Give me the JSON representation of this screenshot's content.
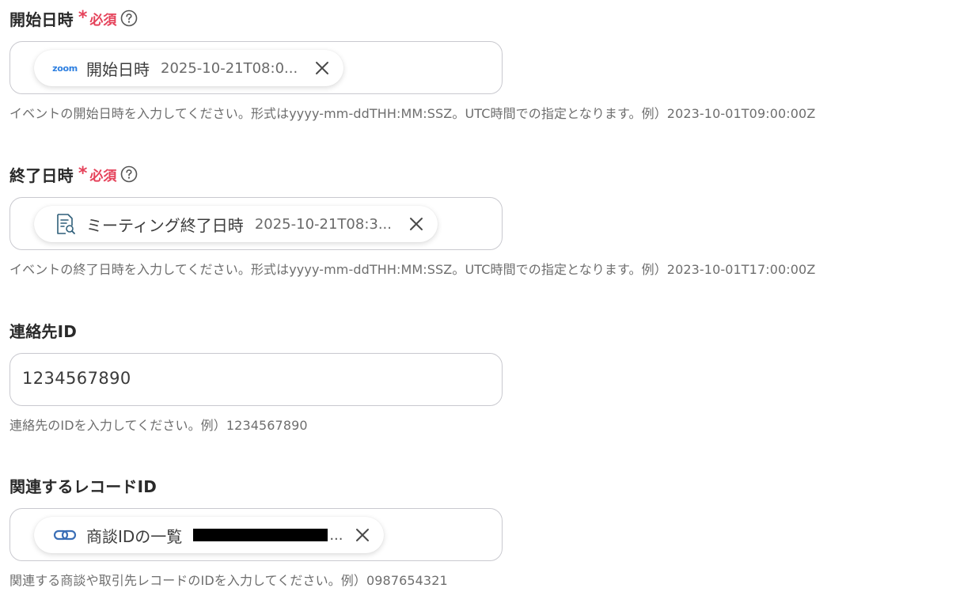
{
  "fields": [
    {
      "label": "開始日時",
      "required_star": "*",
      "required_text": "必須",
      "help_icon": "question-circle-icon",
      "chip": {
        "icon": "zoom-logo-icon",
        "icon_text": "zoom",
        "name": "開始日時",
        "value": "2025-10-21T08:0..."
      },
      "description": "イベントの開始日時を入力してください。形式はyyyy-mm-ddTHH:MM:SSZ。UTC時間での指定となります。例）2023-10-01T09:00:00Z"
    },
    {
      "label": "終了日時",
      "required_star": "*",
      "required_text": "必須",
      "help_icon": "question-circle-icon",
      "chip": {
        "icon": "document-search-icon",
        "name": "ミーティング終了日時",
        "value": "2025-10-21T08:3..."
      },
      "description": "イベントの終了日時を入力してください。形式はyyyy-mm-ddTHH:MM:SSZ。UTC時間での指定となります。例）2023-10-01T17:00:00Z"
    },
    {
      "label": "連絡先ID",
      "value": "1234567890",
      "description": "連絡先のIDを入力してください。例）1234567890"
    },
    {
      "label": "関連するレコードID",
      "chip": {
        "icon": "chain-link-icon",
        "name": "商談IDの一覧",
        "value": "..."
      },
      "description": "関連する商談や取引先レコードのIDを入力してください。例）0987654321"
    }
  ],
  "colors": {
    "required": "#e5425a",
    "border": "#c9c9cf",
    "zoom_blue": "#2d7fe0",
    "link_blue": "#3b6fb6"
  }
}
